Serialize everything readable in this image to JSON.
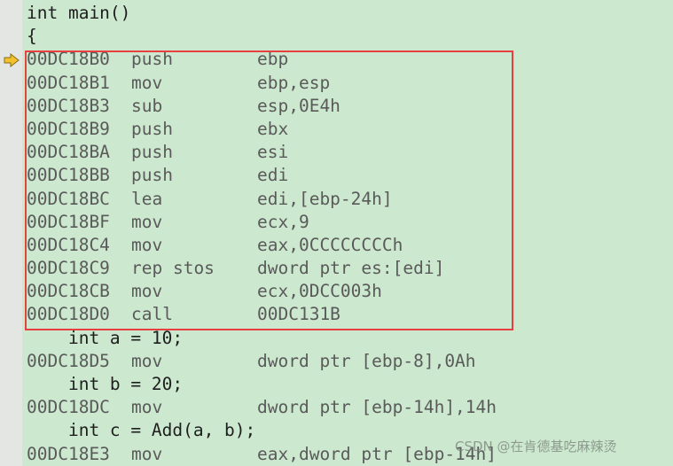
{
  "lines": [
    {
      "type": "src",
      "text": "int main()"
    },
    {
      "type": "src",
      "text": "{"
    },
    {
      "type": "asm",
      "addr": "00DC18B0",
      "mn": "push",
      "op": "ebp"
    },
    {
      "type": "asm",
      "addr": "00DC18B1",
      "mn": "mov",
      "op": "ebp,esp"
    },
    {
      "type": "asm",
      "addr": "00DC18B3",
      "mn": "sub",
      "op": "esp,0E4h"
    },
    {
      "type": "asm",
      "addr": "00DC18B9",
      "mn": "push",
      "op": "ebx"
    },
    {
      "type": "asm",
      "addr": "00DC18BA",
      "mn": "push",
      "op": "esi"
    },
    {
      "type": "asm",
      "addr": "00DC18BB",
      "mn": "push",
      "op": "edi"
    },
    {
      "type": "asm",
      "addr": "00DC18BC",
      "mn": "lea",
      "op": "edi,[ebp-24h]"
    },
    {
      "type": "asm",
      "addr": "00DC18BF",
      "mn": "mov",
      "op": "ecx,9"
    },
    {
      "type": "asm",
      "addr": "00DC18C4",
      "mn": "mov",
      "op": "eax,0CCCCCCCCh"
    },
    {
      "type": "asm",
      "addr": "00DC18C9",
      "mn": "rep stos",
      "op": "dword ptr es:[edi]"
    },
    {
      "type": "asm",
      "addr": "00DC18CB",
      "mn": "mov",
      "op": "ecx,0DCC003h"
    },
    {
      "type": "asm",
      "addr": "00DC18D0",
      "mn": "call",
      "op": "00DC131B"
    },
    {
      "type": "src",
      "text": "    int a = 10;"
    },
    {
      "type": "asm",
      "addr": "00DC18D5",
      "mn": "mov",
      "op": "dword ptr [ebp-8],0Ah"
    },
    {
      "type": "src",
      "text": "    int b = 20;"
    },
    {
      "type": "asm",
      "addr": "00DC18DC",
      "mn": "mov",
      "op": "dword ptr [ebp-14h],14h"
    },
    {
      "type": "src",
      "text": "    int c = Add(a, b);"
    },
    {
      "type": "asm",
      "addr": "00DC18E3",
      "mn": "mov",
      "op": "eax,dword ptr [ebp-14h]"
    }
  ],
  "current_line_icon": "instruction-pointer-arrow-icon",
  "colors": {
    "background": "#cce8cf",
    "highlight_box": "#e84040",
    "arrow": "#f2c12e"
  },
  "watermark": "CSDN @在肯德基吃麻辣烫"
}
